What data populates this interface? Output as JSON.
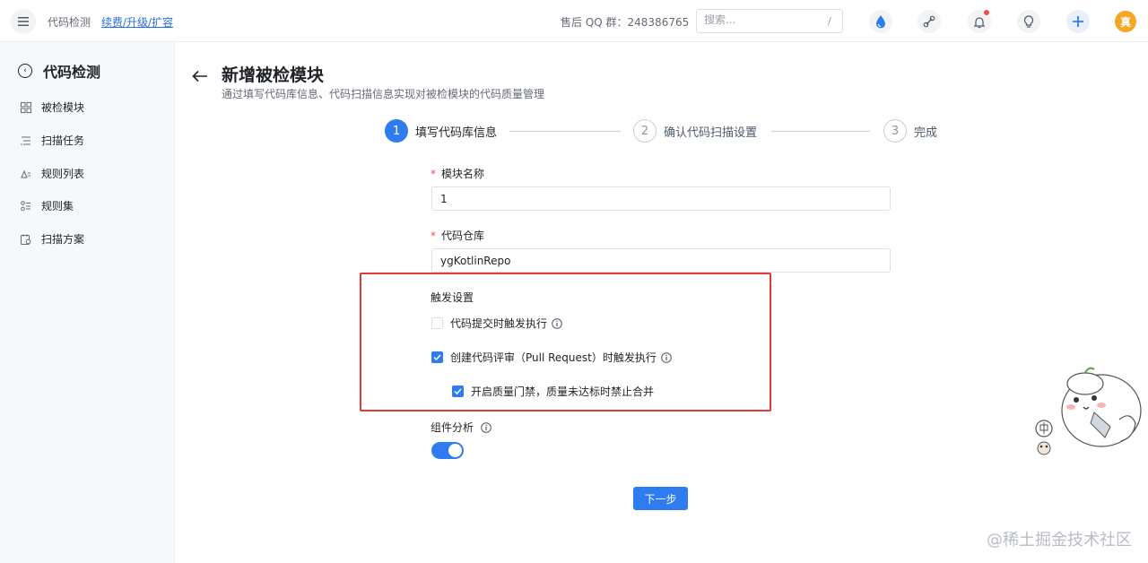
{
  "topbar": {
    "app_title": "代码检测",
    "renew_link": "续费/升级/扩容",
    "qq_group": "售后 QQ 群：248386765",
    "search_placeholder": "搜索...",
    "search_shortcut": "/",
    "avatar_text": "真"
  },
  "sidebar": {
    "title": "代码检测",
    "items": [
      {
        "label": "被检模块",
        "icon": "grid-icon"
      },
      {
        "label": "扫描任务",
        "icon": "task-list-icon"
      },
      {
        "label": "规则列表",
        "icon": "rule-list-icon"
      },
      {
        "label": "规则集",
        "icon": "ruleset-icon"
      },
      {
        "label": "扫描方案",
        "icon": "scan-plan-icon"
      }
    ]
  },
  "page": {
    "title": "新增被检模块",
    "subtitle": "通过填写代码库信息、代码扫描信息实现对被检模块的代码质量管理"
  },
  "steps": [
    {
      "num": "1",
      "label": "填写代码库信息",
      "active": true
    },
    {
      "num": "2",
      "label": "确认代码扫描设置",
      "active": false
    },
    {
      "num": "3",
      "label": "完成",
      "active": false
    }
  ],
  "form": {
    "module_name_label": "模块名称",
    "module_name_value": "1",
    "repo_label": "代码仓库",
    "repo_value": "ygKotlinRepo",
    "trigger_label": "触发设置",
    "trigger_on_commit": "代码提交时触发执行",
    "trigger_on_pr": "创建代码评审（Pull Request）时触发执行",
    "quality_gate": "开启质量门禁，质量未达标时禁止合并",
    "component_analysis_label": "组件分析",
    "next_button": "下一步",
    "required_mark": "*"
  },
  "watermark": "@稀土掘金技术社区",
  "colors": {
    "primary": "#2f7cf0",
    "highlight_border": "#e33b3b",
    "required": "#f54a45"
  }
}
